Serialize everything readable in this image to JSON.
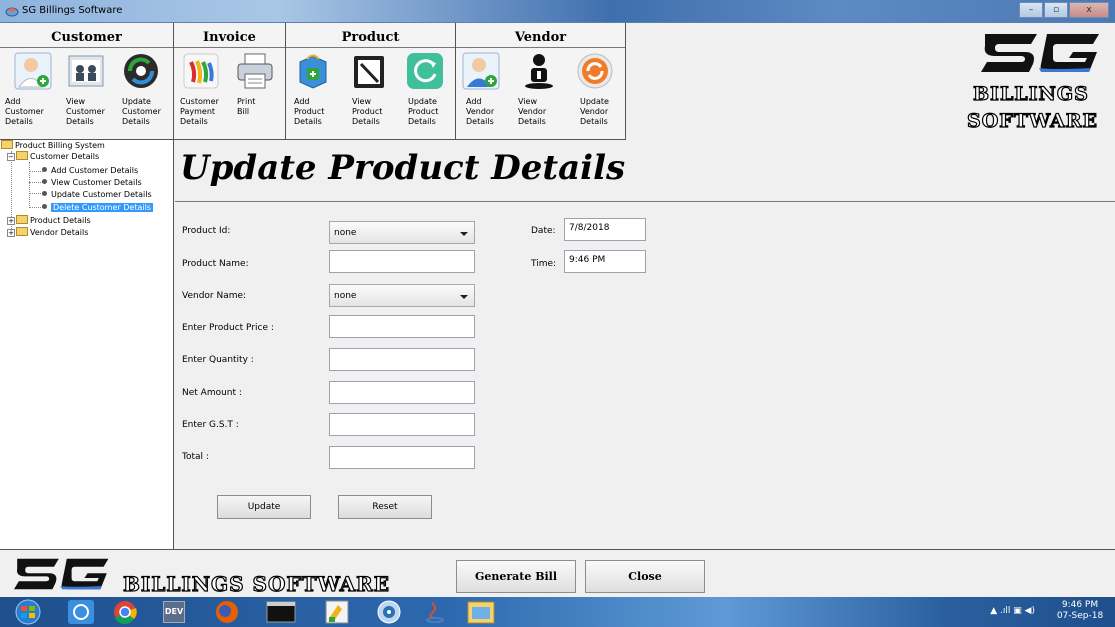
{
  "window": {
    "title": "SG Billings Software"
  },
  "ribbon": {
    "groups": [
      {
        "title": "Customer",
        "buttons": [
          "Add\nCustomer\nDetails",
          "View\nCustomer\nDetails",
          "Update\nCustomer\nDetails"
        ]
      },
      {
        "title": "Invoice",
        "buttons": [
          "Customer\nPayment\nDetails",
          "Print\nBill"
        ]
      },
      {
        "title": "Product",
        "buttons": [
          "Add\nProduct\nDetails",
          "View\nProduct\nDetails",
          "Update\nProduct\nDetails"
        ]
      },
      {
        "title": "Vendor",
        "buttons": [
          "Add\nVendor\nDetails",
          "View\nVendor\nDetails",
          "Update\nVendor\nDetails"
        ]
      }
    ]
  },
  "logo": {
    "mark": "SG",
    "line1": "BILLINGS",
    "line2": "SOFTWARE",
    "full": "BILLINGS SOFTWARE"
  },
  "tree": {
    "root": "Product Billing System",
    "customer": "Customer Details",
    "customer_children": [
      "Add Customer Details",
      "View Customer Details",
      "Update Customer Details",
      "Delete Customer Details"
    ],
    "product": "Product Details",
    "vendor": "Vendor Details"
  },
  "form": {
    "heading": "Update Product Details",
    "product_id_label": "Product Id:",
    "product_id_value": "none",
    "product_name_label": "Product Name:",
    "vendor_name_label": "Vendor Name:",
    "vendor_name_value": "none",
    "price_label": "Enter Product Price :",
    "quantity_label": "Enter Quantity :",
    "net_amount_label": "Net Amount :",
    "gst_label": "Enter G.S.T :",
    "total_label": "Total :",
    "date_label": "Date:",
    "date_value": "7/8/2018",
    "time_label": "Time:",
    "time_value": "9:46 PM",
    "update_label": "Update",
    "reset_label": "Reset"
  },
  "footer": {
    "generate_bill": "Generate Bill",
    "close": "Close"
  },
  "taskbar": {
    "time": "9:46 PM",
    "date": "07-Sep-18",
    "dev_icon_text": "DEV"
  },
  "colors": {
    "selection": "#3399ff",
    "taskbar": "#2d68ae"
  }
}
